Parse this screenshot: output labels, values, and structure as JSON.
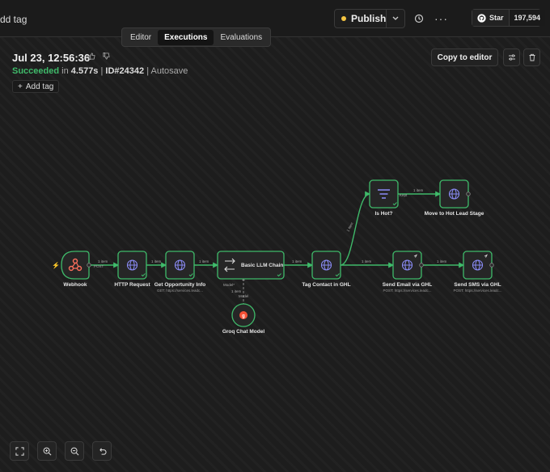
{
  "topbar": {
    "add_tag_partial": "dd tag",
    "publish_label": "Publish",
    "github_star_label": "Star",
    "github_star_count": "197,594"
  },
  "tabs": [
    {
      "label": "Editor",
      "active": false
    },
    {
      "label": "Executions",
      "active": true
    },
    {
      "label": "Evaluations",
      "active": false
    }
  ],
  "execution": {
    "title": "Jul 23, 12:56:36",
    "status_word": "Succeeded",
    "duration_prefix": " in ",
    "duration": "4.577s",
    "sep": " | ",
    "id_label": "ID#24342",
    "mode": "Autosave",
    "add_tag_label": "Add tag"
  },
  "actions": {
    "copy_to_editor": "Copy to editor"
  },
  "colors": {
    "success": "#3fba6a",
    "node_border": "#3fba6a",
    "edge": "#3fba6a",
    "globe": "#8b8cf7",
    "webhook": "#ff6f5c",
    "publish_dot": "#f5c542"
  },
  "nodes": [
    {
      "id": "webhook",
      "label": "Webhook",
      "icon": "webhook-icon"
    },
    {
      "id": "http",
      "label": "HTTP Request",
      "icon": "globe-icon"
    },
    {
      "id": "get-opp",
      "label": "Get Opportunity Info",
      "sub": "GET: https://services.leadc...",
      "icon": "globe-icon"
    },
    {
      "id": "llm",
      "label": "Basic LLM Chain",
      "icon": "chain-icon"
    },
    {
      "id": "groq",
      "label": "Groq Chat Model",
      "icon": "groq-icon"
    },
    {
      "id": "tag",
      "label": "Tag Contact in GHL",
      "icon": "globe-icon"
    },
    {
      "id": "ishot",
      "label": "Is Hot?",
      "icon": "filter-icon"
    },
    {
      "id": "hotlead",
      "label": "Move to Hot Lead Stage",
      "icon": "globe-icon"
    },
    {
      "id": "email",
      "label": "Send Email via GHL",
      "sub": "POST: https://services.leadc...",
      "icon": "globe-icon"
    },
    {
      "id": "sms",
      "label": "Send SMS via GHL",
      "sub": "POST: https://services.leadc...",
      "icon": "globe-icon"
    }
  ],
  "edges": {
    "one_item": "1 item",
    "post": "POST",
    "kept": "Kept",
    "model": "Model*",
    "model_sub": "Model"
  }
}
